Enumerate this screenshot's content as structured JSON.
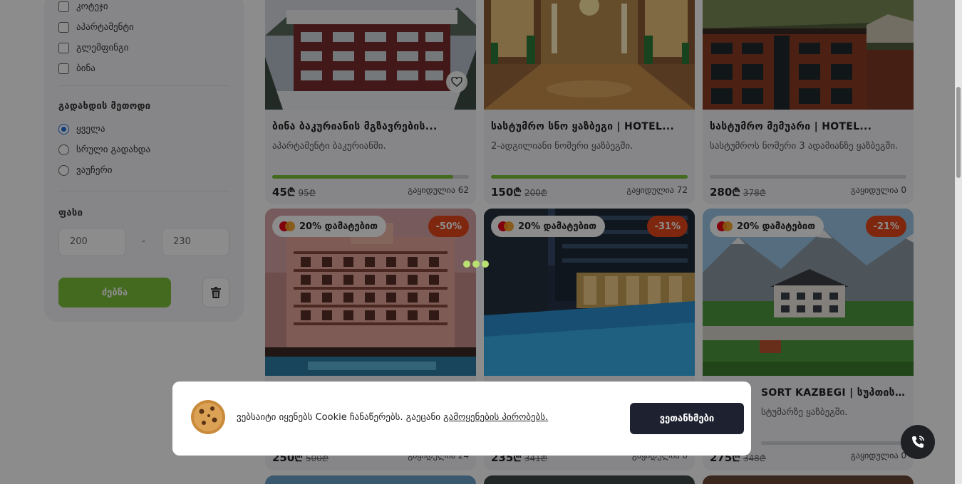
{
  "filters": {
    "property_types": [
      {
        "label": "კოტეჯი",
        "checked": false
      },
      {
        "label": "აპარტამენტი",
        "checked": false
      },
      {
        "label": "გლემფინგი",
        "checked": false
      },
      {
        "label": "ბინა",
        "checked": false
      }
    ],
    "payment_title": "გადახდის მეთოდი",
    "payment_options": [
      {
        "label": "ყველა",
        "selected": true
      },
      {
        "label": "სრული გადახდა",
        "selected": false
      },
      {
        "label": "ვაუჩერი",
        "selected": false
      }
    ],
    "price_title": "ფასი",
    "price_min": "200",
    "price_dash": "-",
    "price_max": "230",
    "search_label": "ძებნა"
  },
  "cards": [
    {
      "title": "ბინა ბაკურიანის მგზავრების...",
      "desc": "აპარტამენტი ბაკურიანში.",
      "price": "45₾",
      "old_price": "95₾",
      "sold": "გაყიდულია 62",
      "progress": 0.92
    },
    {
      "title": "სასტუმრო სნო ყაზბეგი | HOTEL...",
      "desc": "2-ადგილიანი ნომერი ყაზბეგში.",
      "price": "150₾",
      "old_price": "200₾",
      "sold": "გაყიდულია 72",
      "progress": 1.0
    },
    {
      "title": "სასტუმრო მემუარი | HOTEL...",
      "desc": "სასტუმროს ნომერი 3 ადამიანზე ყაზბეგში.",
      "price": "280₾",
      "old_price": "378₾",
      "sold": "გაყიდულია 0",
      "progress": 0
    },
    {
      "promo": "20% დამატებით",
      "discount": "-50%",
      "price": "250₾",
      "old_price": "500₾",
      "sold": "გაყიდულია 24"
    },
    {
      "promo": "20% დამატებით",
      "discount": "-31%",
      "price": "235₾",
      "old_price": "341₾",
      "sold": "გაყიდულია 0"
    },
    {
      "promo": "20% დამატებით",
      "discount": "-21%",
      "title": "SORT KAZBEGI | სუპთის...",
      "desc": "სტუმარზე ყაზბეგში.",
      "price": "275₾",
      "old_price": "348₾",
      "sold": "გაყიდულია 0",
      "progress": 0
    }
  ],
  "cookie": {
    "text": "ვებსაიტი იყენებს Cookie ჩანაწერებს. გაეცანი",
    "link": "გამოყენების პირობებს.",
    "accept": "ვეთანხმები"
  },
  "colors": {
    "accent": "#7cc23a",
    "discount": "#e8471b",
    "dark": "#1e2130"
  },
  "icons": [
    "checkbox-icon",
    "radio-icon",
    "trash-icon",
    "heart-icon",
    "mastercard-icon",
    "cookie-icon",
    "phone-icon"
  ]
}
